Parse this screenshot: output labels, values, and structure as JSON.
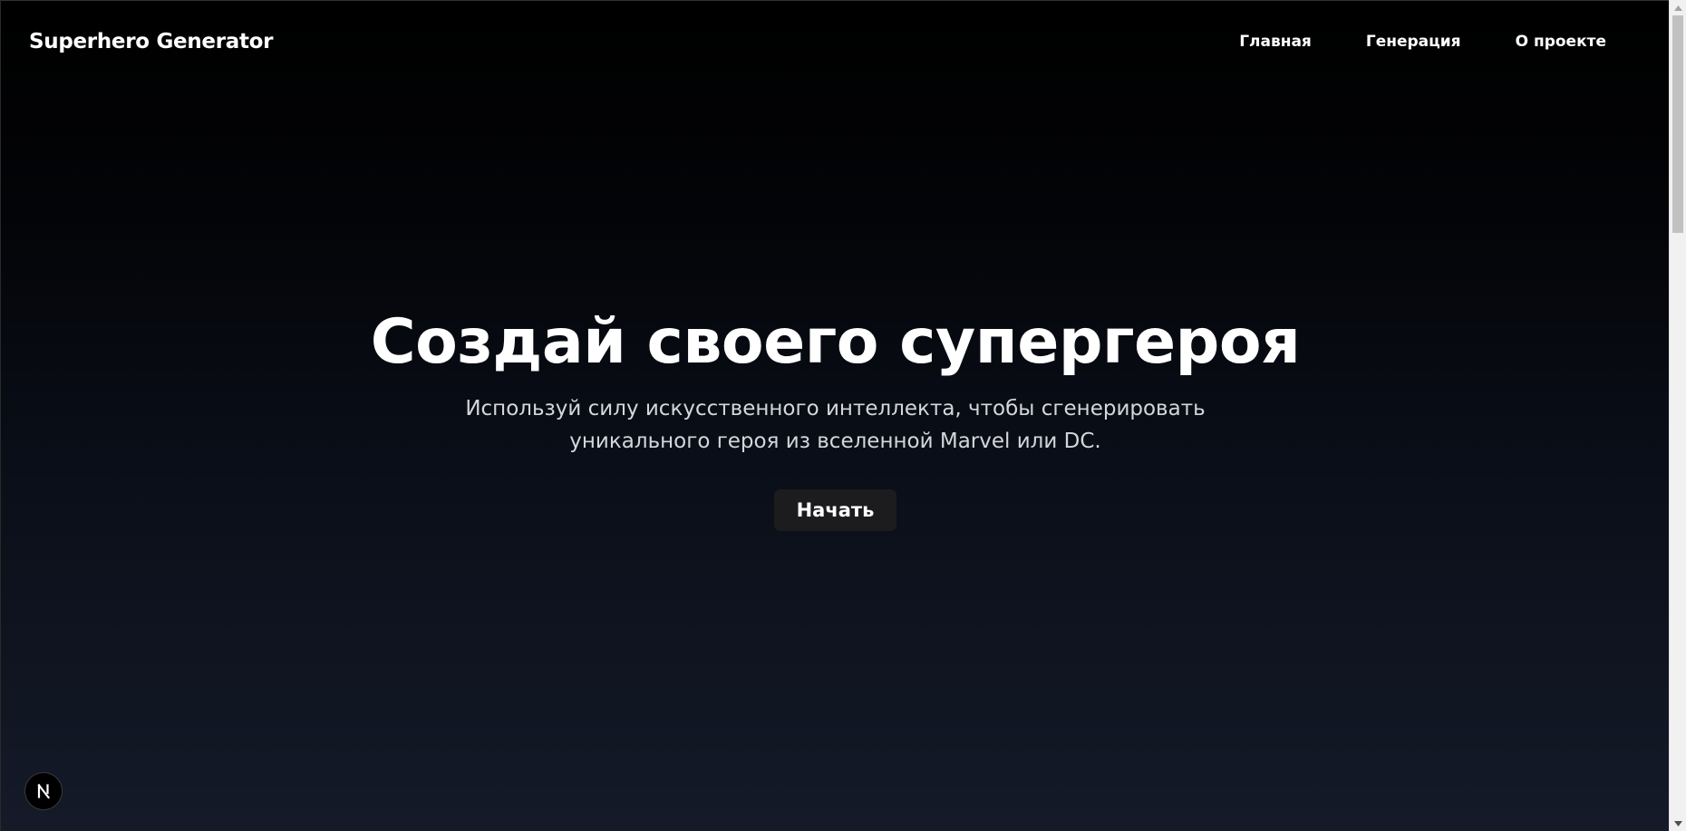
{
  "navbar": {
    "brand": "Superhero Generator",
    "links": [
      {
        "label": "Главная"
      },
      {
        "label": "Генерация"
      },
      {
        "label": "О проекте"
      }
    ]
  },
  "hero": {
    "title": "Создай своего супергероя",
    "subtitle": "Используй силу искусственного интеллекта, чтобы сгенерировать уникального героя из вселенной Marvel или DC.",
    "cta_label": "Начать"
  },
  "dev_badge": {
    "icon": "nextjs-icon",
    "letter": "N"
  },
  "scrollbar": {
    "position_fraction": 0.0
  },
  "colors": {
    "background_top": "#000000",
    "background_bottom": "#141a28",
    "text": "#ffffff",
    "subtitle": "#d4d6dc",
    "button_bg": "#1c1c1e"
  }
}
